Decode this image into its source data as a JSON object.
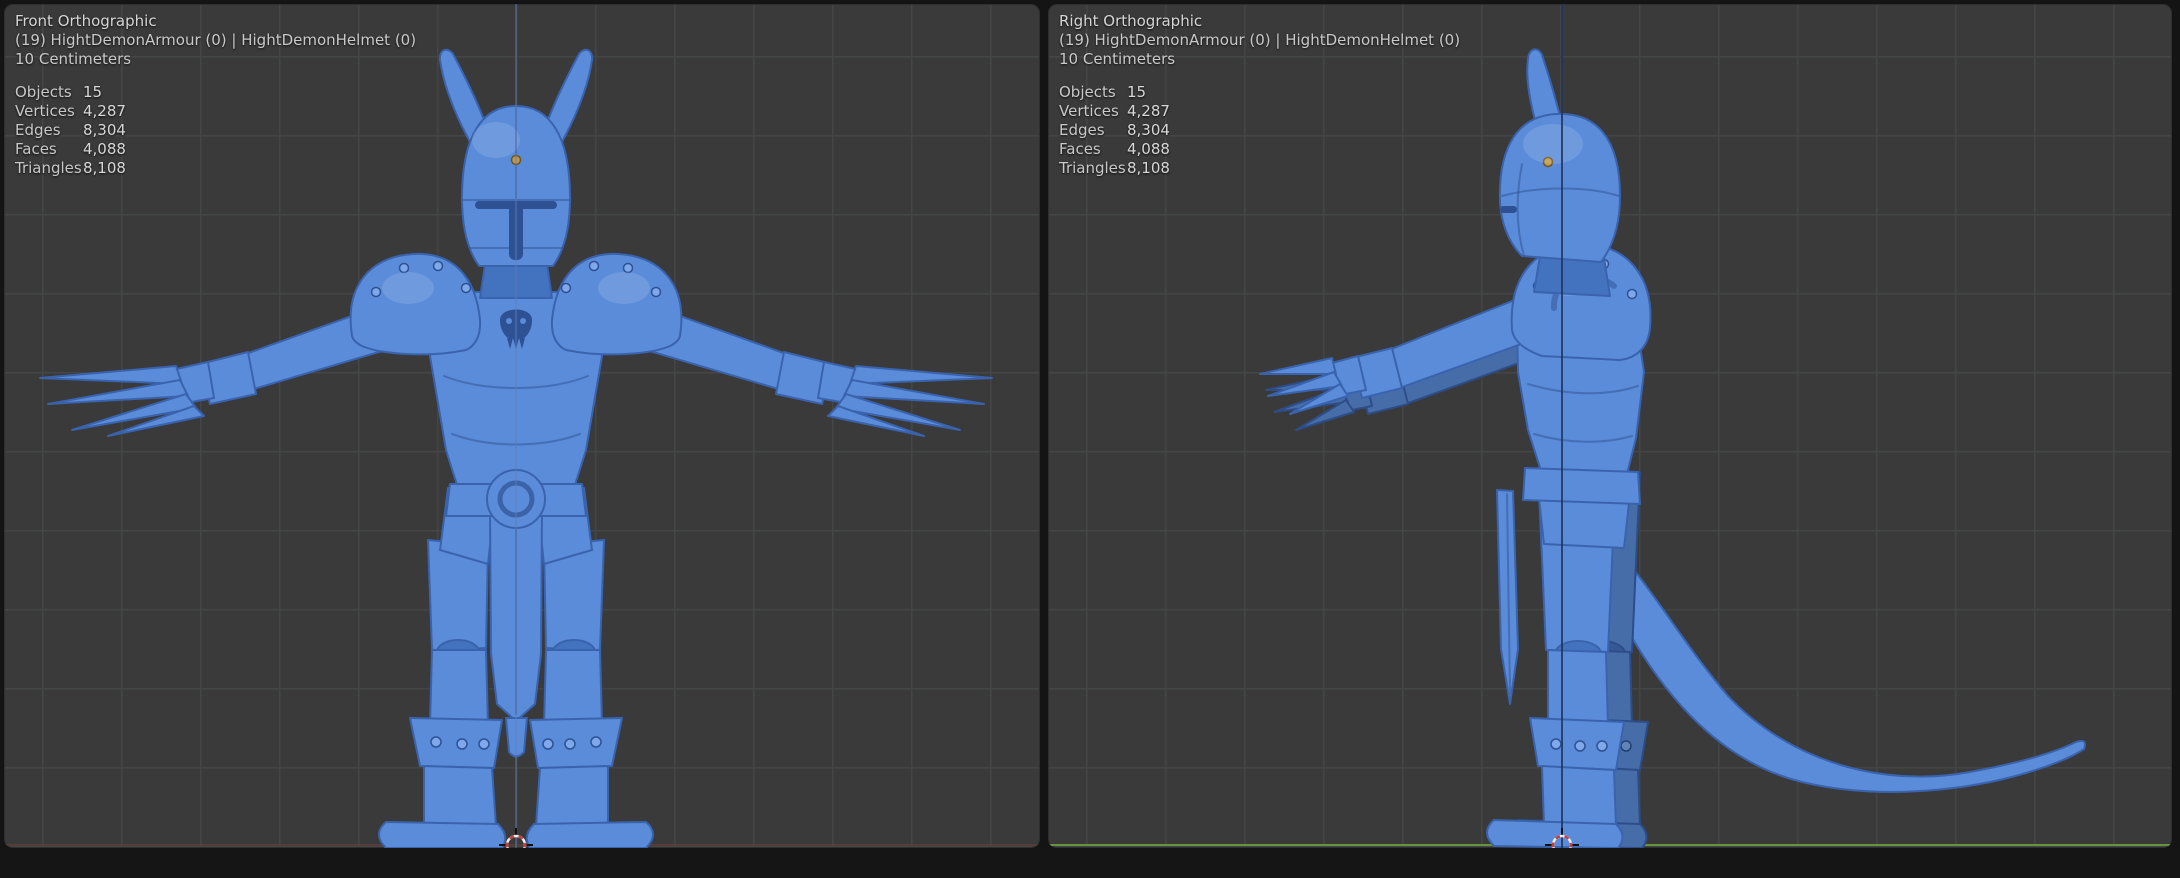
{
  "app": {
    "name": "3D Viewport - Orthographic Views"
  },
  "colors": {
    "viewport-bg": "#3a3a3a",
    "grid-line": "#444546",
    "overlay-text": "#d6d6d6",
    "model-fill": "#5b8cd9",
    "model-stroke": "#3a63ae",
    "model-dark": "#4372bf",
    "model-darker": "#2d5193",
    "model-light": "#7ea8ea",
    "rivet-gold": "#c09a4e",
    "axis-y-green": "#67993d",
    "axis-z-blue": "#22355c",
    "axis-x-red": "#6e3c3c",
    "cursor-red": "#c8403e",
    "cursor-white": "#ececec"
  },
  "viewports": [
    {
      "view_label": "Front Orthographic",
      "collection_label": "(19) HightDemonArmour (0) | HightDemonHelmet (0)",
      "scale_label": "10 Centimeters",
      "stats": [
        {
          "label": "Objects",
          "value": "15"
        },
        {
          "label": "Vertices",
          "value": "4,287"
        },
        {
          "label": "Edges",
          "value": "8,304"
        },
        {
          "label": "Faces",
          "value": "4,088"
        },
        {
          "label": "Triangles",
          "value": "8,108"
        }
      ]
    },
    {
      "view_label": "Right Orthographic",
      "collection_label": "(19) HightDemonArmour (0) | HightDemonHelmet (0)",
      "scale_label": "10 Centimeters",
      "stats": [
        {
          "label": "Objects",
          "value": "15"
        },
        {
          "label": "Vertices",
          "value": "4,287"
        },
        {
          "label": "Edges",
          "value": "8,304"
        },
        {
          "label": "Faces",
          "value": "4,088"
        },
        {
          "label": "Triangles",
          "value": "8,108"
        }
      ]
    }
  ]
}
